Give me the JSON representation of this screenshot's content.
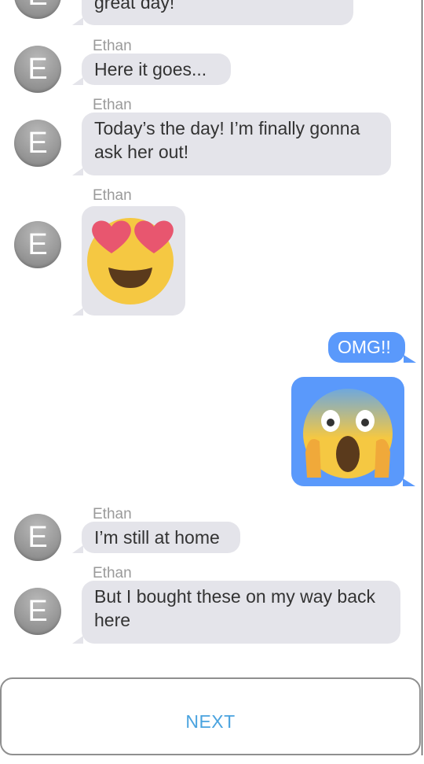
{
  "contact": {
    "name": "Ethan",
    "initial": "E"
  },
  "messages": [
    {
      "id": "m0",
      "from": "Ethan",
      "text": "great day!"
    },
    {
      "id": "m1",
      "from": "Ethan",
      "text": "Here it goes..."
    },
    {
      "id": "m2",
      "from": "Ethan",
      "text": "Today’s the day! I’m finally gonna ask her out!"
    },
    {
      "id": "m3",
      "from": "Ethan",
      "emoji": "heart-eyes-emoji"
    },
    {
      "id": "m4",
      "from": "me",
      "text": "OMG!!"
    },
    {
      "id": "m5",
      "from": "me",
      "emoji": "screaming-in-fear-emoji"
    },
    {
      "id": "m6",
      "from": "Ethan",
      "text": "I’m still at home"
    },
    {
      "id": "m7",
      "from": "Ethan",
      "text": "But I bought these on my way back here"
    }
  ],
  "next_button": {
    "label": "NEXT"
  },
  "colors": {
    "incoming_bubble": "#e4e4ea",
    "outgoing_bubble": "#5a99fb",
    "button_text": "#4aa3df",
    "sender_name": "#9a9a9a"
  }
}
